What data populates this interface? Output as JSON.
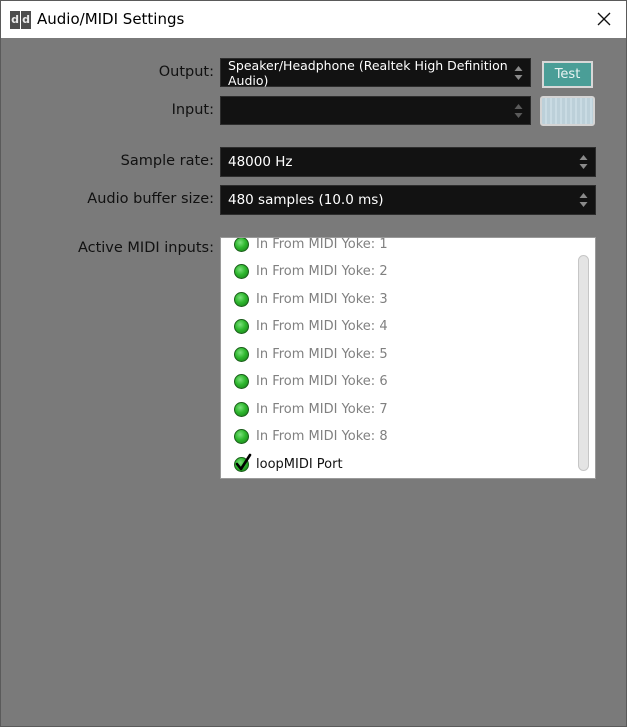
{
  "window": {
    "title": "Audio/MIDI Settings",
    "app_icon_letters": [
      "d",
      "d"
    ]
  },
  "output": {
    "label": "Output:",
    "value": "Speaker/Headphone (Realtek High Definition Audio)",
    "test_label": "Test"
  },
  "input": {
    "label": "Input:",
    "value": ""
  },
  "sample_rate": {
    "label": "Sample rate:",
    "value": "48000 Hz"
  },
  "buffer_size": {
    "label": "Audio buffer size:",
    "value": "480 samples (10.0 ms)"
  },
  "midi": {
    "label": "Active MIDI inputs:",
    "items": [
      {
        "name": "In From MIDI Yoke:  1",
        "enabled": false
      },
      {
        "name": "In From MIDI Yoke:  2",
        "enabled": false
      },
      {
        "name": "In From MIDI Yoke:  3",
        "enabled": false
      },
      {
        "name": "In From MIDI Yoke:  4",
        "enabled": false
      },
      {
        "name": "In From MIDI Yoke:  5",
        "enabled": false
      },
      {
        "name": "In From MIDI Yoke:  6",
        "enabled": false
      },
      {
        "name": "In From MIDI Yoke:  7",
        "enabled": false
      },
      {
        "name": "In From MIDI Yoke:  8",
        "enabled": false
      },
      {
        "name": "loopMIDI Port",
        "enabled": true
      }
    ]
  },
  "colors": {
    "background": "#7a7a7a",
    "combo_bg": "#121212",
    "accent": "#4a9e97"
  }
}
